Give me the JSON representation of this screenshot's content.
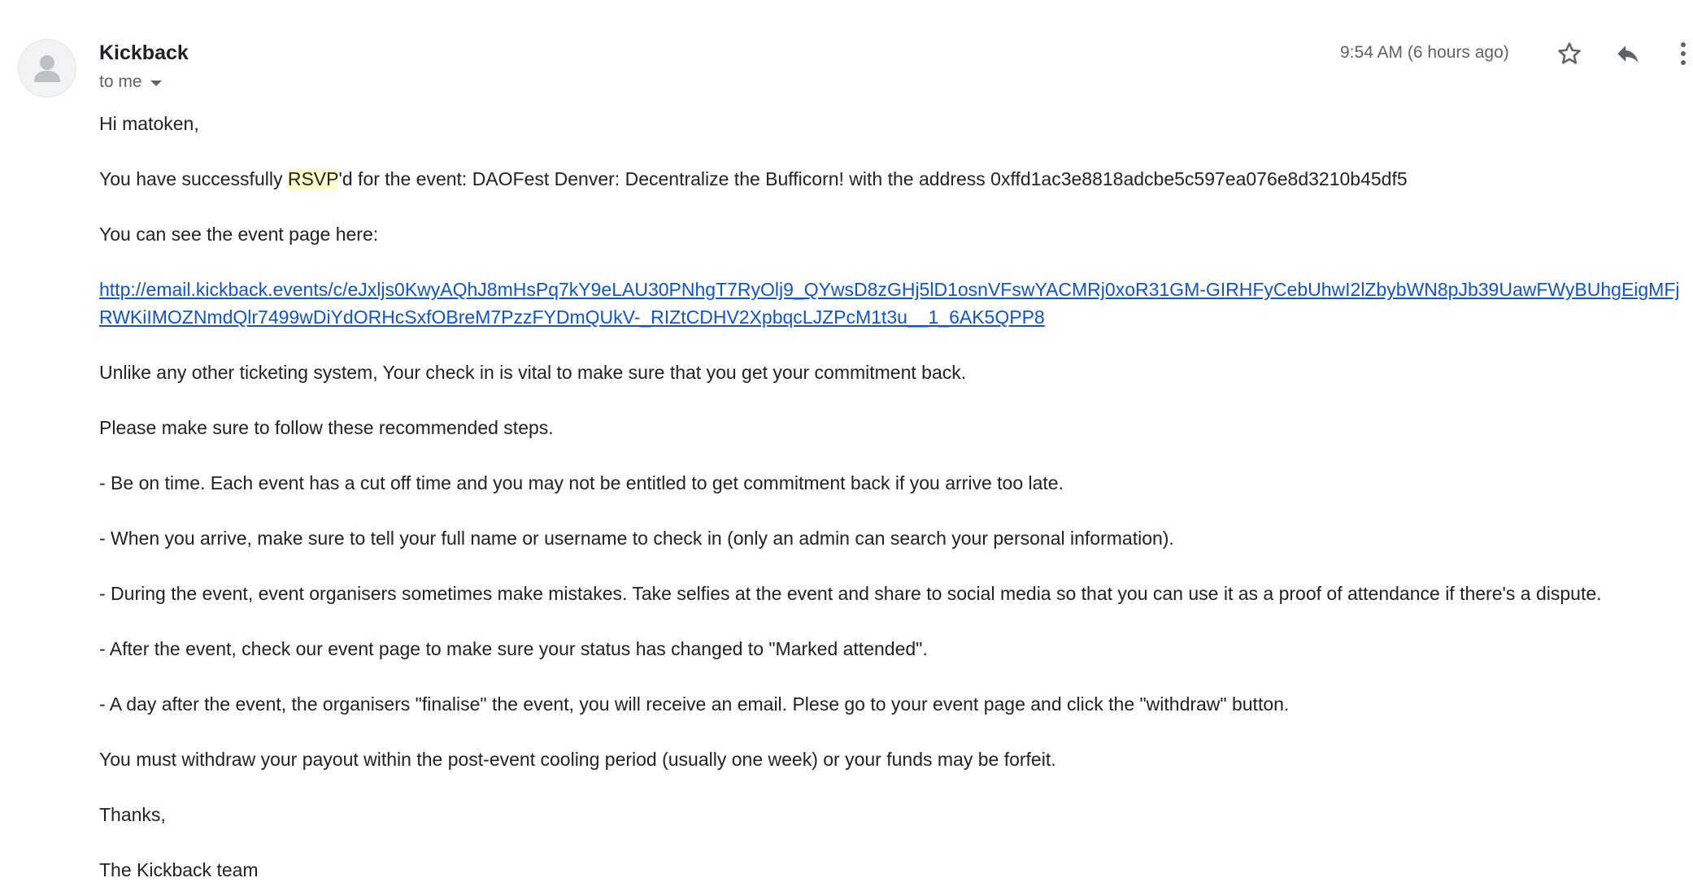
{
  "header": {
    "sender": "Kickback",
    "recipient": "to me",
    "time": "9:54 AM (6 hours ago)"
  },
  "icons": {
    "avatar": "person-avatar-icon",
    "star": "star-outline-icon",
    "reply": "reply-icon",
    "more": "more-vert-icon"
  },
  "colors": {
    "link": "#1155cc",
    "highlight": "#ffffcc",
    "text": "#222222",
    "muted": "#5f6368"
  },
  "body": {
    "greeting": "Hi matoken,",
    "rsvp_before": "You have successfully ",
    "rsvp_highlight": "RSVP",
    "rsvp_after": "'d for the event: DAOFest Denver: Decentralize the Bufficorn!  with the address 0xffd1ac3e8818adcbe5c597ea076e8d3210b45df5",
    "event_page_intro": "You can see the event page here:",
    "event_link": "http://email.kickback.events/c/eJxljs0KwyAQhJ8mHsPq7kY9eLAU30PNhgT7RyOlj9_QYwsD8zGHj5lD1osnVFswYACMRj0xoR31GM-GIRHFyCebUhwI2lZbybWN8pJb39UawFWyBUhgEigMFjRWKiIMOZNmdQlr7499wDiYdORHcSxfOBreM7PzzFYDmQUkV-_RIZtCDHV2XpbqcLJZPcM1t3u__1_6AK5QPP8",
    "checkin_vital": "Unlike any other ticketing system, Your check in is vital to make sure that you get your commitment back.",
    "steps_intro": "Please make sure to follow these recommended steps.",
    "step1": "- Be on time. Each event has a cut off time and you may not be entitled to get commitment back if you arrive too late.",
    "step2": "- When you arrive, make sure to tell your full name or username to check in (only an admin can search your personal information).",
    "step3": "- During the event, event organisers sometimes make mistakes. Take selfies at the event and share to social media so that you can use it as a proof of attendance if there's a dispute.",
    "step4": "- After the event, check our event page to make sure your status has changed to \"Marked attended\".",
    "step5": "- A day after the event, the organisers \"finalise\" the event, you will receive an email. Plese go to your event page and click the \"withdraw\" button.",
    "withdraw_note": "You must withdraw your payout within the post-event cooling period (usually one week) or your funds may be forfeit.",
    "signoff": "Thanks,",
    "signature": "The Kickback team"
  }
}
